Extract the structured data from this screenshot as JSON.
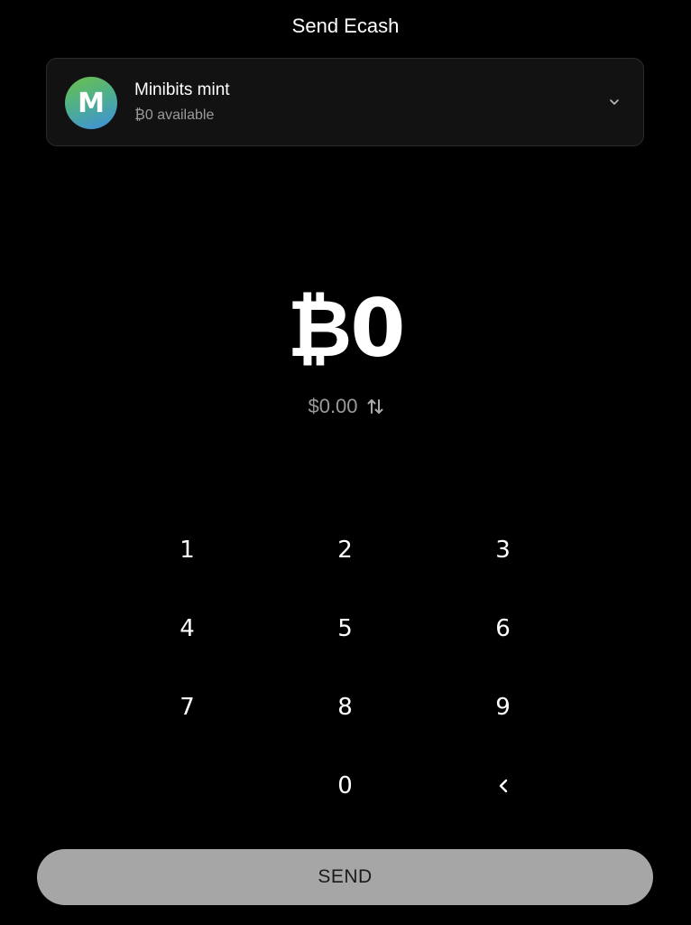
{
  "header": {
    "title": "Send Ecash"
  },
  "mint": {
    "avatar_letter": "M",
    "name": "Minibits mint",
    "balance": "₿0 available",
    "chevron_icon": "chevron-down-icon"
  },
  "amount": {
    "value": "₿0",
    "fiat": "$0.00",
    "swap_icon": "swap-vertical-icon"
  },
  "keypad": {
    "keys": [
      "1",
      "2",
      "3",
      "4",
      "5",
      "6",
      "7",
      "8",
      "9",
      "",
      "0",
      "<"
    ],
    "backspace_icon": "chevron-left-icon"
  },
  "footer": {
    "send_label": "SEND"
  },
  "colors": {
    "background": "#000000",
    "card": "#121212",
    "muted_text": "#9a9a9a",
    "button": "#a6a6a6"
  }
}
